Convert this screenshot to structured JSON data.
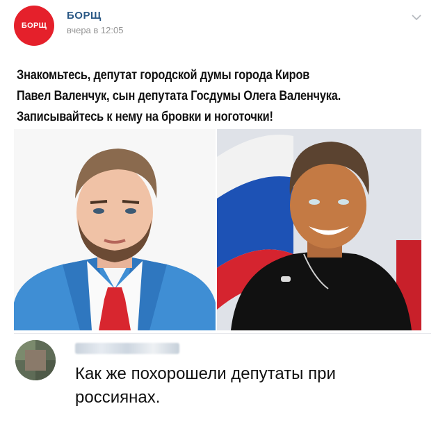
{
  "header": {
    "avatar_text": "БОРЩ",
    "author": "БОРЩ",
    "timestamp": "вчера в 12:05",
    "more_icon": "chevron-down-icon"
  },
  "post": {
    "lines": [
      "Знакомьтесь, депутат городской думы города Киров",
      "Павел Валенчук, сын депутата Госдумы Олега Валенчука.",
      "Записывайтесь к нему на бровки и ноготочки!"
    ]
  },
  "comment": {
    "author": "",
    "text_line1": "Как же похорошели депутаты при",
    "text_line2": "россиянах."
  },
  "colors": {
    "brand_red": "#e5202b",
    "author_blue": "#2a5885",
    "muted": "#939393"
  }
}
